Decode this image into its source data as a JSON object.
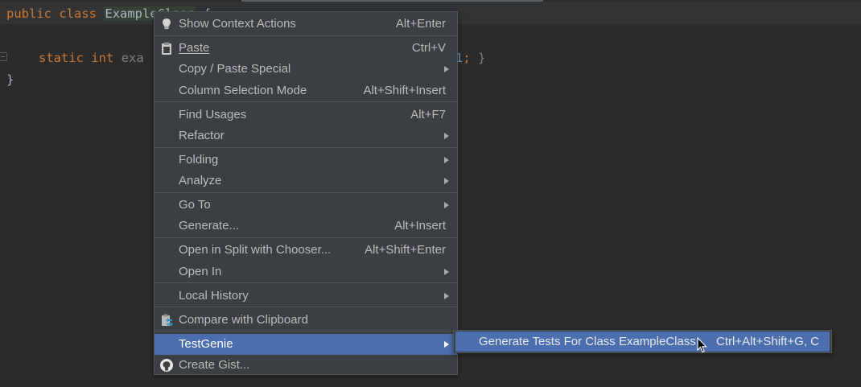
{
  "editor": {
    "line1": {
      "kw_public": "public",
      "kw_class": "class",
      "class_name": "ExampleClass",
      "brace_open": "{"
    },
    "line2": {
      "kw_static": "static",
      "kw_int": "int",
      "field_start": "exa",
      "tail_num": "1",
      "tail_semicolon": ";",
      "tail_brace": "}"
    },
    "line3": {
      "brace_close": "}"
    }
  },
  "context_menu": {
    "items": [
      {
        "label": "Show Context Actions",
        "shortcut": "Alt+Enter",
        "icon": "lightbulb-icon"
      },
      {
        "label": "Paste",
        "shortcut": "Ctrl+V",
        "icon": "clipboard-icon"
      },
      {
        "label": "Copy / Paste Special",
        "shortcut": ""
      },
      {
        "label": "Column Selection Mode",
        "shortcut": "Alt+Shift+Insert"
      },
      {
        "label": "Find Usages",
        "shortcut": "Alt+F7"
      },
      {
        "label": "Refactor",
        "shortcut": ""
      },
      {
        "label": "Folding",
        "shortcut": ""
      },
      {
        "label": "Analyze",
        "shortcut": ""
      },
      {
        "label": "Go To",
        "shortcut": ""
      },
      {
        "label": "Generate...",
        "shortcut": "Alt+Insert"
      },
      {
        "label": "Open in Split with Chooser...",
        "shortcut": "Alt+Shift+Enter"
      },
      {
        "label": "Open In",
        "shortcut": ""
      },
      {
        "label": "Local History",
        "shortcut": ""
      },
      {
        "label": "Compare with Clipboard",
        "shortcut": "",
        "icon": "compare-icon"
      },
      {
        "label": "TestGenie",
        "shortcut": "",
        "selected": true
      },
      {
        "label": "Create Gist...",
        "shortcut": "",
        "icon": "github-icon"
      }
    ]
  },
  "submenu": {
    "label": "Generate Tests For Class ExampleClass",
    "shortcut": "Ctrl+Alt+Shift+G, C"
  },
  "colors": {
    "editor_bg": "#2b2b2b",
    "menu_bg": "#3c3f41",
    "selection": "#4b6eaf",
    "keyword": "#cc7832",
    "text": "#bbbbbb"
  }
}
